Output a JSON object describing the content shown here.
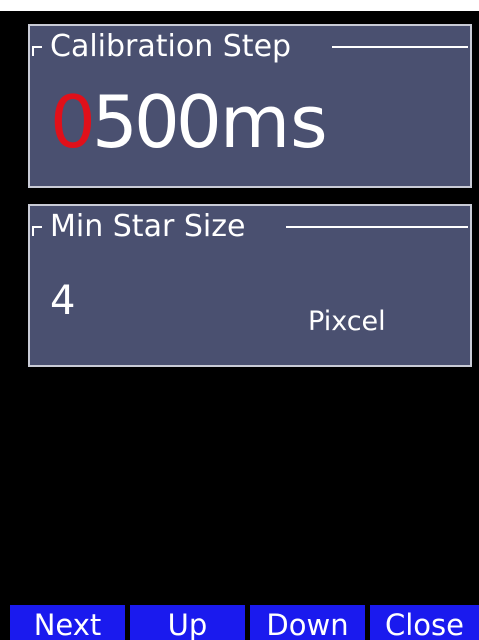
{
  "calibration_panel": {
    "title": "Calibration Step",
    "digits": [
      "0",
      "5",
      "0",
      "0"
    ],
    "active_digit_index": 0,
    "unit": "ms"
  },
  "star_panel": {
    "title": "Min Star Size",
    "value": "4",
    "unit": "Pixcel"
  },
  "softkeys": {
    "next_label": "Next",
    "up_label": "Up",
    "down_label": "Down",
    "close_label": "Close"
  },
  "colors": {
    "background": "#000000",
    "panel": "#4a5070",
    "active_digit": "#e0101a",
    "softkey": "#1a1aee"
  }
}
